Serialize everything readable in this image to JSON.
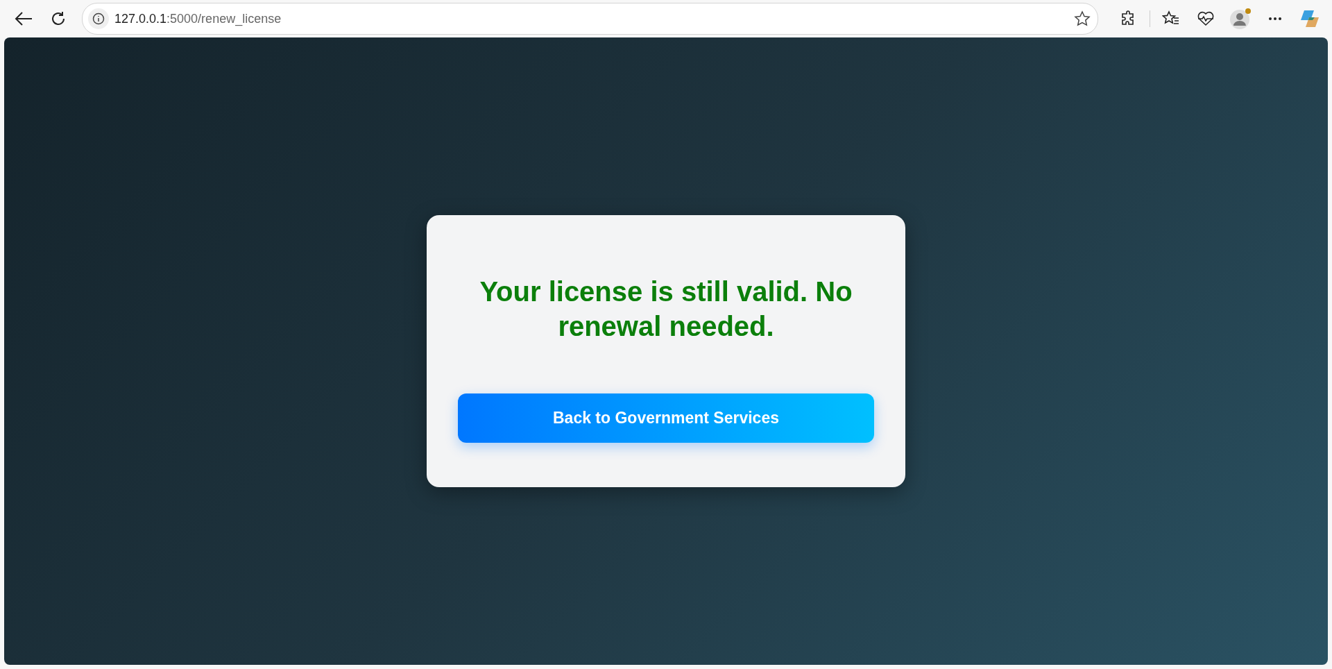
{
  "browser": {
    "address_bar": {
      "host": "127.0.0.1",
      "path": ":5000/renew_license"
    }
  },
  "card": {
    "message": "Your license is still valid. No renewal needed.",
    "button": "Back to Government Services"
  }
}
